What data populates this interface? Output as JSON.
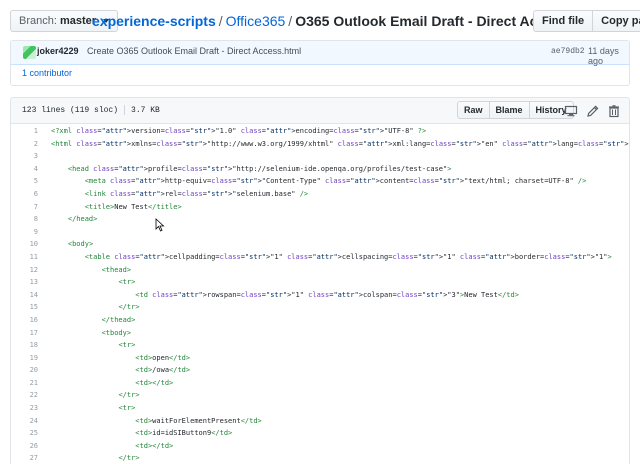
{
  "toolbar": {
    "branch_label": "Branch:",
    "branch_value": "master",
    "find_file": "Find file",
    "copy_path": "Copy path"
  },
  "breadcrumb": {
    "repo": "experience-scripts",
    "sep1": "/",
    "dir": "Office365",
    "sep2": "/",
    "file": "O365 Outlook Email Draft - Direct Access.html"
  },
  "commit": {
    "author": "joker4229",
    "message": "Create O365 Outlook Email Draft - Direct Access.html",
    "sha": "ae79db2",
    "time_ago": "11 days ago",
    "contributors": "1 contributor"
  },
  "file": {
    "lines_info": "123 lines (119 sloc)",
    "size": "3.7 KB",
    "raw": "Raw",
    "blame": "Blame",
    "history": "History",
    "icons": [
      "desktop-icon",
      "pencil-icon",
      "trash-icon"
    ]
  },
  "code": {
    "lines": [
      {
        "n": "1",
        "t": "<?xml version=\"1.0\" encoding=\"UTF-8\" ?>"
      },
      {
        "n": "2",
        "t": "<html xmlns=\"http://www.w3.org/1999/xhtml\" xml:lang=\"en\" lang=\"en\">"
      },
      {
        "n": "3",
        "t": ""
      },
      {
        "n": "4",
        "t": "    <head profile=\"http://selenium-ide.openqa.org/profiles/test-case\">"
      },
      {
        "n": "5",
        "t": "        <meta http-equiv=\"Content-Type\" content=\"text/html; charset=UTF-8\" />"
      },
      {
        "n": "6",
        "t": "        <link rel=\"selenium.base\" />"
      },
      {
        "n": "7",
        "t": "        <title>New Test</title>"
      },
      {
        "n": "8",
        "t": "    </head>"
      },
      {
        "n": "9",
        "t": ""
      },
      {
        "n": "10",
        "t": "    <body>"
      },
      {
        "n": "11",
        "t": "        <table cellpadding=\"1\" cellspacing=\"1\" border=\"1\">"
      },
      {
        "n": "12",
        "t": "            <thead>"
      },
      {
        "n": "13",
        "t": "                <tr>"
      },
      {
        "n": "14",
        "t": "                    <td rowspan=\"1\" colspan=\"3\">New Test</td>"
      },
      {
        "n": "15",
        "t": "                </tr>"
      },
      {
        "n": "16",
        "t": "            </thead>"
      },
      {
        "n": "17",
        "t": "            <tbody>"
      },
      {
        "n": "18",
        "t": "                <tr>"
      },
      {
        "n": "19",
        "t": "                    <td>open</td>"
      },
      {
        "n": "20",
        "t": "                    <td>/owa</td>"
      },
      {
        "n": "21",
        "t": "                    <td></td>"
      },
      {
        "n": "22",
        "t": "                </tr>"
      },
      {
        "n": "23",
        "t": "                <tr>"
      },
      {
        "n": "24",
        "t": "                    <td>waitForElementPresent</td>"
      },
      {
        "n": "25",
        "t": "                    <td>id=idSIButton9</td>"
      },
      {
        "n": "26",
        "t": "                    <td></td>"
      },
      {
        "n": "27",
        "t": "                </tr>"
      }
    ]
  }
}
